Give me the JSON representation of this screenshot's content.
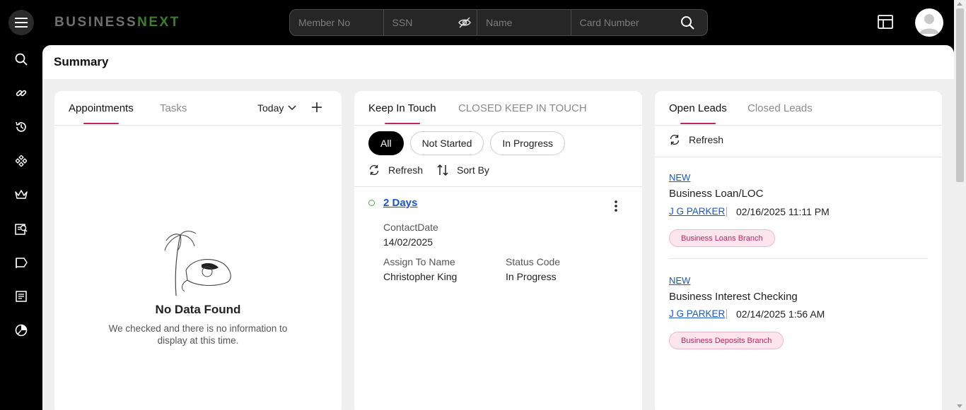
{
  "app": {
    "logo_part1": "BUSINESS",
    "logo_part2": "NEXT",
    "menu_icon": "hamburger-icon",
    "layout_icon": "layout-icon",
    "avatar_icon": "user-avatar-icon"
  },
  "search": {
    "member_placeholder": "Member No",
    "ssn_placeholder": "SSN",
    "name_placeholder": "Name",
    "card_placeholder": "Card Number"
  },
  "sidebar": {
    "items": [
      {
        "icon": "search-icon"
      },
      {
        "icon": "link-icon"
      },
      {
        "icon": "history-icon"
      },
      {
        "icon": "modules-icon"
      },
      {
        "icon": "crown-icon"
      },
      {
        "icon": "reports-icon"
      },
      {
        "icon": "campaign-icon"
      },
      {
        "icon": "document-icon"
      },
      {
        "icon": "dashboard-icon"
      }
    ]
  },
  "page": {
    "title": "Summary"
  },
  "appointments": {
    "tab_appointments": "Appointments",
    "tab_tasks": "Tasks",
    "filter": "Today",
    "empty_title": "No Data Found",
    "empty_message": "We checked and there is no information to display at this time."
  },
  "keep_in_touch": {
    "tab_active": "Keep In Touch",
    "tab_closed": "CLOSED KEEP IN TOUCH",
    "chips": [
      "All",
      "Not Started",
      "In Progress"
    ],
    "refresh": "Refresh",
    "sort_by": "Sort By",
    "item": {
      "title": "2 Days",
      "contact_date_label": "ContactDate",
      "contact_date": "14/02/2025",
      "assign_label": "Assign To Name",
      "assign_value": "Christopher King",
      "status_label": "Status Code",
      "status_value": "In Progress"
    }
  },
  "leads": {
    "tab_open": "Open Leads",
    "tab_closed": "Closed Leads",
    "refresh": "Refresh",
    "items": [
      {
        "status": "NEW",
        "title": "Business Loan/LOC",
        "user": "J G PARKER",
        "date": "02/16/2025 11:11 PM",
        "tag": "Business Loans Branch"
      },
      {
        "status": "NEW",
        "title": "Business Interest Checking",
        "user": "J G PARKER",
        "date": "02/14/2025 1:56 AM",
        "tag": "Business Deposits Branch"
      }
    ]
  },
  "colors": {
    "accent": "#c4245e",
    "link": "#1a56c4",
    "logo_green": "#3f7d2e"
  }
}
